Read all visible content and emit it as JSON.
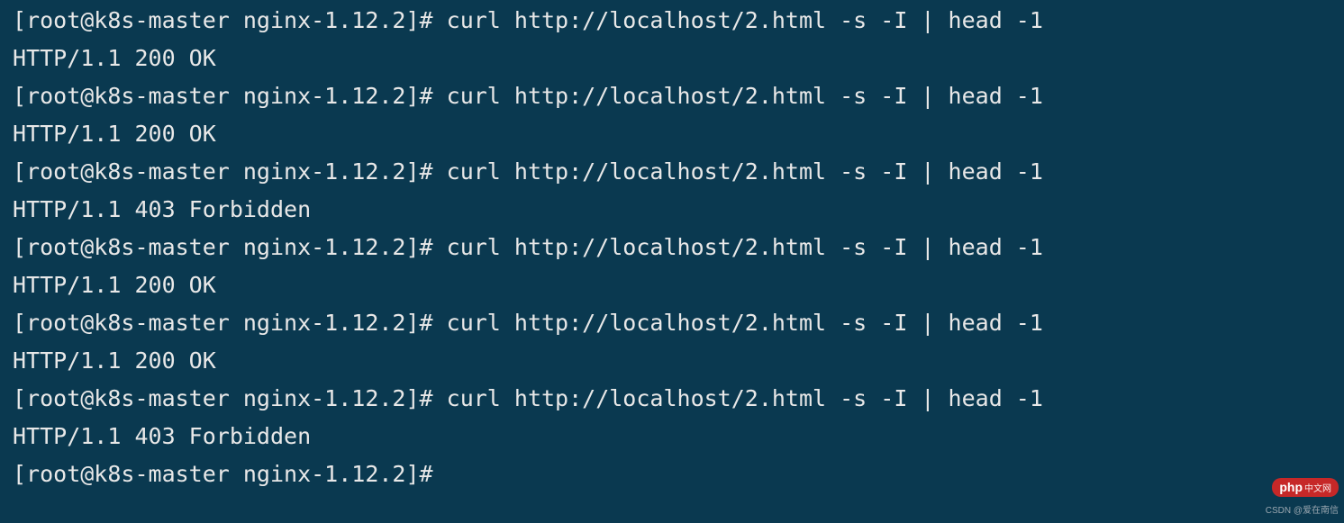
{
  "terminal": {
    "prompt": "[root@k8s-master nginx-1.12.2]#",
    "cmd": "curl http://localhost/2.html -s -I | head -1",
    "resp_ok": "HTTP/1.1 200 OK",
    "resp_forbidden": "HTTP/1.1 403 Forbidden",
    "lines": [
      {
        "kind": "cmd"
      },
      {
        "kind": "ok"
      },
      {
        "kind": "cmd"
      },
      {
        "kind": "ok"
      },
      {
        "kind": "cmd"
      },
      {
        "kind": "forbidden"
      },
      {
        "kind": "cmd"
      },
      {
        "kind": "ok"
      },
      {
        "kind": "cmd"
      },
      {
        "kind": "ok"
      },
      {
        "kind": "cmd"
      },
      {
        "kind": "forbidden"
      },
      {
        "kind": "prompt_only"
      }
    ]
  },
  "watermark": {
    "logo_main": "php",
    "logo_sub": "中文网",
    "subtitle": "CSDN @爱在南信"
  }
}
